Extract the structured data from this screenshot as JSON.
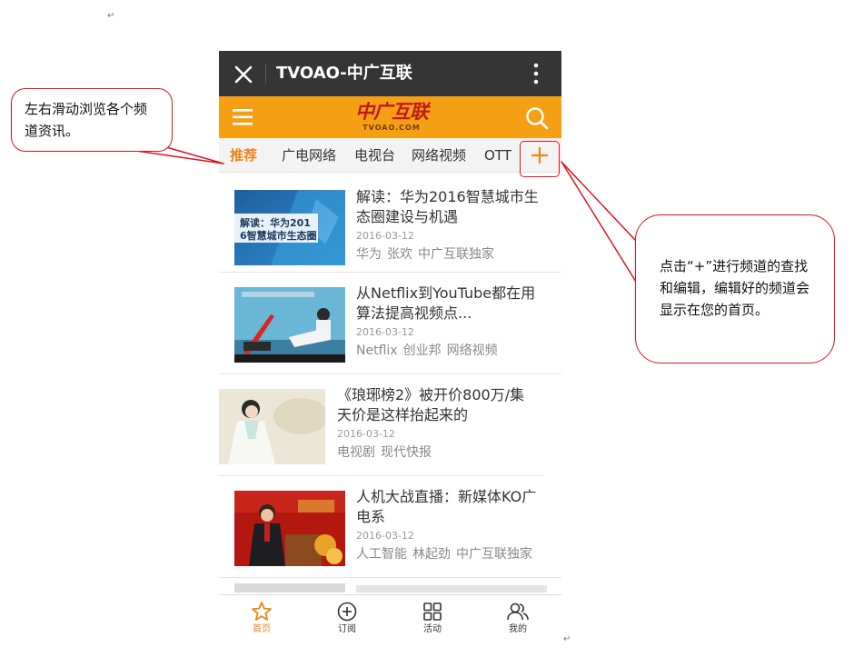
{
  "header": {
    "title": "TVOAO-中广互联",
    "logo_text": "中广互联",
    "logo_sub": "TVOAO.COM",
    "close_icon": "close-icon",
    "more_icon": "more-vertical-icon",
    "menu_icon": "menu-icon",
    "search_icon": "search-icon"
  },
  "tabs": {
    "items": [
      "推荐",
      "广电网络",
      "电视台",
      "网络视频",
      "OTT"
    ],
    "active_index": 0,
    "add_icon": "plus-icon"
  },
  "articles": [
    {
      "title": "解读：华为2016智慧城市生态圈建设与机遇",
      "date": "2016-03-12",
      "tags": [
        "华为",
        "张欢",
        "中广互联独家"
      ],
      "thumb_caption": [
        "解读：华为201",
        "6智慧城市生态圈"
      ]
    },
    {
      "title": "从Netflix到YouTube都在用算法提高视频点...",
      "date": "2016-03-12",
      "tags": [
        "Netflix",
        "创业邦",
        "网络视频"
      ]
    },
    {
      "title": "《琅琊榜2》被开价800万/集天价是这样抬起来的",
      "date": "2016-03-12",
      "tags": [
        "电视剧",
        "现代快报"
      ]
    },
    {
      "title": "人机大战直播：新媒体KO广电系",
      "date": "2016-03-12",
      "tags": [
        "人工智能",
        "林起劲",
        "中广互联独家"
      ]
    }
  ],
  "bottom_nav": [
    {
      "label": "首页",
      "icon": "star-icon",
      "active": true
    },
    {
      "label": "订阅",
      "icon": "add-circle-icon",
      "active": false
    },
    {
      "label": "活动",
      "icon": "grid-icon",
      "active": false
    },
    {
      "label": "我的",
      "icon": "user-group-icon",
      "active": false
    }
  ],
  "callouts": {
    "left": "左右滑动浏览各个频道资讯。",
    "right": "点击“+”进行频道的查找和编辑，编辑好的频道会显示在您的首页。"
  },
  "colors": {
    "accent": "#f5a014",
    "active_text": "#f08419",
    "title_bar": "#353535",
    "annotation": "#e0141e"
  }
}
